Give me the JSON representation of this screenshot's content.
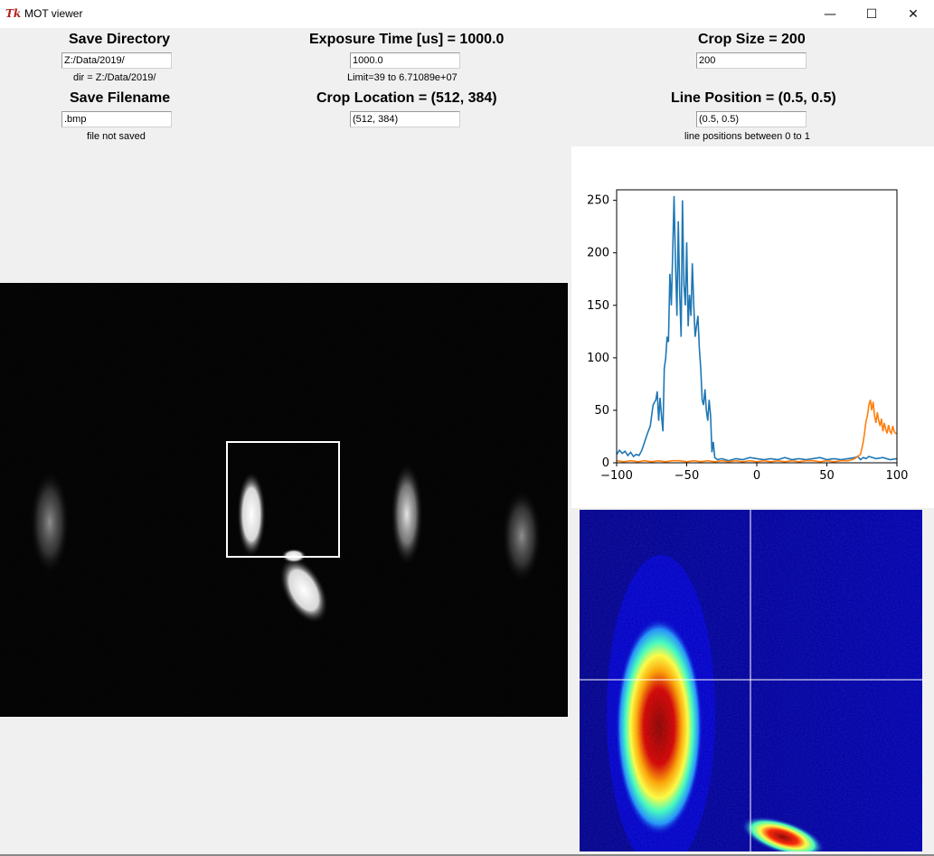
{
  "window": {
    "title": "MOT viewer",
    "minimize_glyph": "—",
    "maximize_glyph": "☐",
    "close_glyph": "✕",
    "icon": "tk-feather-icon",
    "icon_text": "Tk"
  },
  "save_directory": {
    "heading": "Save Directory",
    "value": "Z:/Data/2019/",
    "status": "dir = Z:/Data/2019/"
  },
  "save_filename": {
    "heading": "Save Filename",
    "value": ".bmp",
    "status": "file not saved"
  },
  "exposure": {
    "heading": "Exposure Time [us] = 1000.0",
    "value": "1000.0",
    "limit": "Limit=39 to 6.71089e+07"
  },
  "crop_location": {
    "heading": "Crop Location = (512, 384)",
    "value": "(512, 384)"
  },
  "crop_size": {
    "heading": "Crop Size = 200",
    "value": "200"
  },
  "line_position": {
    "heading": "Line Position = (0.5, 0.5)",
    "value": "(0.5, 0.5)",
    "note": "line positions between 0 to 1"
  },
  "colors": {
    "series_blue": "#1f77b4",
    "series_orange": "#ff7f0e",
    "crop_box": "#ffffff"
  },
  "chart_data": {
    "type": "line",
    "title": "",
    "xlabel": "",
    "ylabel": "",
    "xlim": [
      -100,
      100
    ],
    "ylim": [
      0,
      260
    ],
    "xticks": [
      -100,
      -50,
      0,
      50,
      100
    ],
    "yticks": [
      0,
      50,
      100,
      150,
      200,
      250
    ],
    "xtick_labels": [
      "−100",
      "−50",
      "0",
      "50",
      "100"
    ],
    "ytick_labels": [
      "0",
      "50",
      "100",
      "150",
      "200",
      "250"
    ],
    "grid": false,
    "series": [
      {
        "color": "#1f77b4",
        "points": [
          [
            -100,
            8
          ],
          [
            -98,
            12
          ],
          [
            -96,
            9
          ],
          [
            -94,
            11
          ],
          [
            -92,
            7
          ],
          [
            -90,
            10
          ],
          [
            -88,
            6
          ],
          [
            -86,
            8
          ],
          [
            -84,
            7
          ],
          [
            -82,
            12
          ],
          [
            -80,
            20
          ],
          [
            -78,
            28
          ],
          [
            -76,
            35
          ],
          [
            -74,
            55
          ],
          [
            -72,
            60
          ],
          [
            -71,
            68
          ],
          [
            -70,
            40
          ],
          [
            -69,
            62
          ],
          [
            -68,
            45
          ],
          [
            -67,
            30
          ],
          [
            -66,
            90
          ],
          [
            -65,
            100
          ],
          [
            -64,
            120
          ],
          [
            -63,
            115
          ],
          [
            -62,
            180
          ],
          [
            -61,
            150
          ],
          [
            -60,
            200
          ],
          [
            -59,
            254
          ],
          [
            -58,
            190
          ],
          [
            -57,
            140
          ],
          [
            -56,
            230
          ],
          [
            -55,
            160
          ],
          [
            -54,
            120
          ],
          [
            -53,
            250
          ],
          [
            -52,
            170
          ],
          [
            -51,
            150
          ],
          [
            -50,
            210
          ],
          [
            -49,
            130
          ],
          [
            -48,
            160
          ],
          [
            -47,
            140
          ],
          [
            -46,
            190
          ],
          [
            -45,
            150
          ],
          [
            -44,
            120
          ],
          [
            -43,
            130
          ],
          [
            -42,
            140
          ],
          [
            -41,
            110
          ],
          [
            -40,
            90
          ],
          [
            -39,
            60
          ],
          [
            -38,
            55
          ],
          [
            -37,
            70
          ],
          [
            -36,
            50
          ],
          [
            -35,
            40
          ],
          [
            -34,
            60
          ],
          [
            -33,
            45
          ],
          [
            -32,
            10
          ],
          [
            -31,
            20
          ],
          [
            -30,
            5
          ],
          [
            -28,
            3
          ],
          [
            -25,
            4
          ],
          [
            -20,
            2
          ],
          [
            -15,
            4
          ],
          [
            -10,
            3
          ],
          [
            -5,
            5
          ],
          [
            0,
            4
          ],
          [
            5,
            3
          ],
          [
            10,
            4
          ],
          [
            15,
            3
          ],
          [
            20,
            5
          ],
          [
            25,
            3
          ],
          [
            30,
            4
          ],
          [
            35,
            3
          ],
          [
            40,
            4
          ],
          [
            45,
            5
          ],
          [
            50,
            3
          ],
          [
            55,
            4
          ],
          [
            60,
            3
          ],
          [
            65,
            4
          ],
          [
            70,
            5
          ],
          [
            72,
            6
          ],
          [
            74,
            3
          ],
          [
            76,
            5
          ],
          [
            78,
            4
          ],
          [
            80,
            6
          ],
          [
            85,
            4
          ],
          [
            90,
            5
          ],
          [
            95,
            3
          ],
          [
            100,
            4
          ]
        ]
      },
      {
        "color": "#ff7f0e",
        "points": [
          [
            -100,
            2
          ],
          [
            -95,
            1
          ],
          [
            -90,
            2
          ],
          [
            -85,
            1
          ],
          [
            -80,
            2
          ],
          [
            -75,
            1
          ],
          [
            -70,
            2
          ],
          [
            -65,
            1
          ],
          [
            -60,
            2
          ],
          [
            -55,
            2
          ],
          [
            -50,
            1
          ],
          [
            -45,
            2
          ],
          [
            -40,
            1
          ],
          [
            -35,
            2
          ],
          [
            -30,
            1
          ],
          [
            -25,
            2
          ],
          [
            -20,
            1
          ],
          [
            -15,
            2
          ],
          [
            -10,
            1
          ],
          [
            -5,
            2
          ],
          [
            0,
            1
          ],
          [
            5,
            2
          ],
          [
            10,
            1
          ],
          [
            15,
            2
          ],
          [
            20,
            1
          ],
          [
            25,
            2
          ],
          [
            30,
            1
          ],
          [
            35,
            2
          ],
          [
            40,
            2
          ],
          [
            45,
            1
          ],
          [
            50,
            2
          ],
          [
            55,
            1
          ],
          [
            60,
            2
          ],
          [
            65,
            2
          ],
          [
            68,
            3
          ],
          [
            70,
            4
          ],
          [
            72,
            6
          ],
          [
            74,
            8
          ],
          [
            75,
            14
          ],
          [
            76,
            20
          ],
          [
            77,
            30
          ],
          [
            78,
            40
          ],
          [
            79,
            45
          ],
          [
            80,
            55
          ],
          [
            81,
            60
          ],
          [
            82,
            50
          ],
          [
            83,
            58
          ],
          [
            84,
            45
          ],
          [
            85,
            38
          ],
          [
            86,
            48
          ],
          [
            87,
            40
          ],
          [
            88,
            35
          ],
          [
            89,
            42
          ],
          [
            90,
            30
          ],
          [
            91,
            38
          ],
          [
            92,
            32
          ],
          [
            93,
            28
          ],
          [
            94,
            36
          ],
          [
            95,
            30
          ],
          [
            96,
            28
          ],
          [
            97,
            35
          ],
          [
            98,
            30
          ],
          [
            99,
            28
          ],
          [
            100,
            28
          ]
        ]
      }
    ]
  }
}
